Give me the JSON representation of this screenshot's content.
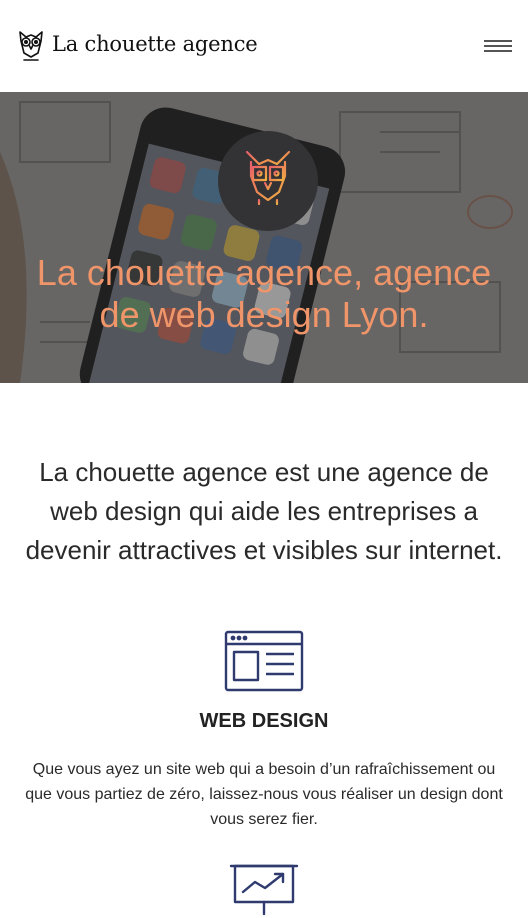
{
  "header": {
    "brand_name": "La chouette agence",
    "logo_icon": "owl-icon",
    "menu_icon": "hamburger-menu-icon"
  },
  "hero": {
    "title": "La chouette agence, agence de web design Lyon.",
    "logo_icon": "owl-icon",
    "accent_color": "#f0956a"
  },
  "intro": {
    "text": "La chouette agence est une agence de web design qui aide les entreprises a devenir attractives et visibles sur internet."
  },
  "services": [
    {
      "icon": "browser-window-icon",
      "title": "WEB DESIGN",
      "description": "Que vous ayez un site web qui a besoin d’un rafraîchissement ou que vous partiez de zéro, laissez-nous vous réaliser un design dont vous serez fier."
    },
    {
      "icon": "presentation-chart-icon"
    }
  ],
  "colors": {
    "icon_navy": "#2f3b6e",
    "hero_title": "#f0956a"
  }
}
